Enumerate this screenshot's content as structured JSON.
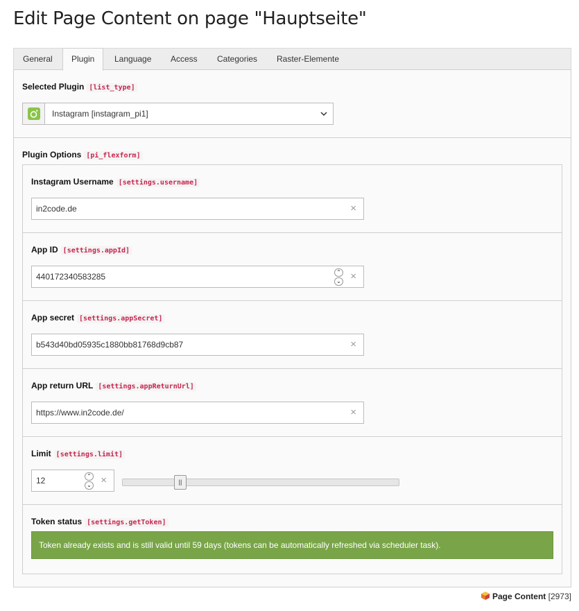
{
  "page": {
    "title": "Edit Page Content on page \"Hauptseite\""
  },
  "tabs": [
    {
      "label": "General"
    },
    {
      "label": "Plugin",
      "active": true
    },
    {
      "label": "Language"
    },
    {
      "label": "Access"
    },
    {
      "label": "Categories"
    },
    {
      "label": "Raster-Elemente"
    }
  ],
  "plugin": {
    "label": "Selected Plugin",
    "key": "[list_type]",
    "selected": "Instagram [instagram_pi1]",
    "icon": "instagram-plugin-icon",
    "icon_color": "#8bc34a"
  },
  "options": {
    "label": "Plugin Options",
    "key": "[pi_flexform]",
    "fields": [
      {
        "label": "Instagram Username",
        "key": "[settings.username]",
        "value": "in2code.de"
      },
      {
        "label": "App ID",
        "key": "[settings.appId]",
        "value": "440172340583285"
      },
      {
        "label": "App secret",
        "key": "[settings.appSecret]",
        "value": "b543d40bd05935c1880bb81768d9cb87"
      },
      {
        "label": "App return URL",
        "key": "[settings.appReturnUrl]",
        "value": "https://www.in2code.de/"
      },
      {
        "label": "Limit",
        "key": "[settings.limit]",
        "value": "12",
        "slider_fraction": 0.11
      }
    ],
    "token": {
      "label": "Token status",
      "key": "[settings.getToken]",
      "message": "Token already exists and is still valid until 59 days (tokens can be automatically refreshed via scheduler task).",
      "color": "#79a548"
    }
  },
  "footer": {
    "record_type": "Page Content",
    "record_id": "[2973]"
  },
  "icons": {
    "clear": "×",
    "spin_up": "⌃",
    "spin_down": "⌄",
    "handle": "||"
  }
}
